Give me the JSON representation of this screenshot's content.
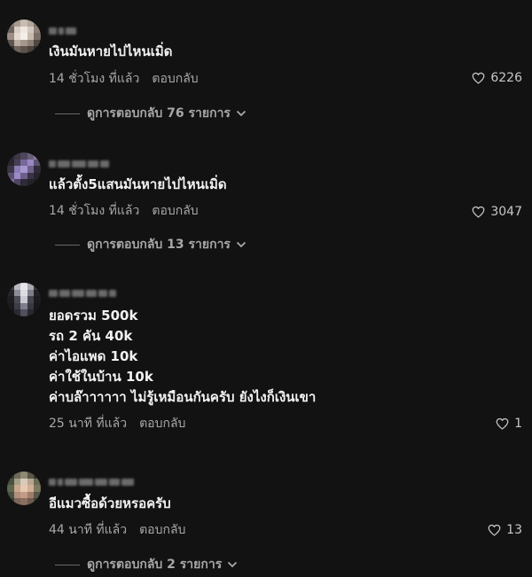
{
  "comments": [
    {
      "text": "เงินมันหายไปไหนเมิ่ด",
      "time": "14 ชั่วโมง ที่แล้ว",
      "reply": "ตอบกลับ",
      "likes": "6226",
      "view_replies": "ดูการตอบกลับ 76 รายการ"
    },
    {
      "text": "แล้วตั้ง5แสนมันหายไปไหนเมิ่ด",
      "time": "14 ชั่วโมง ที่แล้ว",
      "reply": "ตอบกลับ",
      "likes": "3047",
      "view_replies": "ดูการตอบกลับ 13 รายการ"
    },
    {
      "text": "ยอดรวม 500k\nรถ 2 คัน 40k\nค่าไอแพด 10k\nค่าใช้ในบ้าน 10k\nค่าบล๊าาาาาา ไม่รู้เหมือนกันครับ ยังไงก็เงินเขา",
      "time": "25 นาที ที่แล้ว",
      "reply": "ตอบกลับ",
      "likes": "1"
    },
    {
      "text": "อีแมวซื้อด้วยหรอครับ",
      "time": "44 นาที ที่แล้ว",
      "reply": "ตอบกลับ",
      "likes": "13",
      "view_replies": "ดูการตอบกลับ 2 รายการ"
    }
  ],
  "icons": {
    "like": "heart-outline-icon",
    "expand": "chevron-down-icon"
  },
  "colors": {
    "background": "#121212",
    "text": "#f2f2f2",
    "muted": "#a8a8a8"
  }
}
